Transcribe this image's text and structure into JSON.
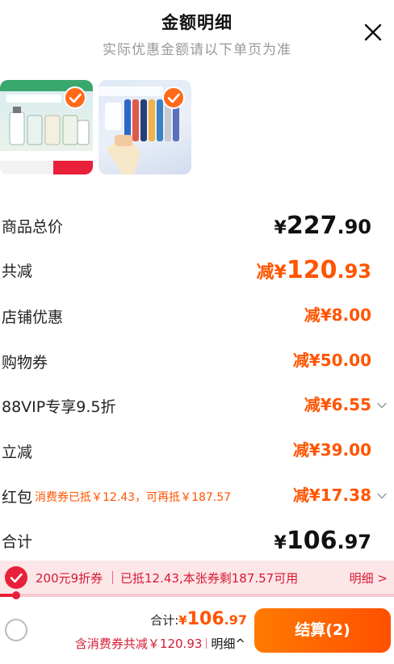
{
  "header": {
    "title": "金额明细",
    "subtitle": "实际优惠金额请以下单页为准"
  },
  "products": [
    {
      "name": "product-thumb-fragrance",
      "selected": true
    },
    {
      "name": "product-thumb-toothbrush",
      "selected": true
    }
  ],
  "rows": {
    "subtotal": {
      "label": "商品总价",
      "yen": "¥",
      "int": "227",
      "dec": ".90"
    },
    "total_reduce": {
      "label": "共减",
      "prefix": "减",
      "yen": "¥",
      "int": "120",
      "dec": ".93"
    },
    "store": {
      "label": "店铺优惠",
      "value": "减¥8.00"
    },
    "shopping_coupon": {
      "label": "购物券",
      "value": "减¥50.00"
    },
    "vip": {
      "label": "88VIP专享9.5折",
      "value": "减¥6.55"
    },
    "instant": {
      "label": "立减",
      "value": "减¥39.00"
    },
    "redpack": {
      "label": "红包",
      "note": "消费券已抵￥12.43，可再抵￥187.57",
      "value": "减¥17.38"
    },
    "total": {
      "label": "合计",
      "yen": "¥",
      "int": "106",
      "dec": ".97"
    }
  },
  "coupon_bar": {
    "name": "200元9折券",
    "detail": "已抵12.43,本张券剩187.57可用",
    "link": "明细 >",
    "progress": 0.04
  },
  "bottom": {
    "total_label": "合计:",
    "total_yen": "¥",
    "total_int": "106",
    "total_dec": ".97",
    "discount": "含消费券共减￥120.93",
    "detail_link": "明细^",
    "settle": "结算(2)"
  },
  "colors": {
    "accent": "#ff5500",
    "coupon_red": "#e8203a",
    "coupon_bg": "#fde6e8"
  }
}
